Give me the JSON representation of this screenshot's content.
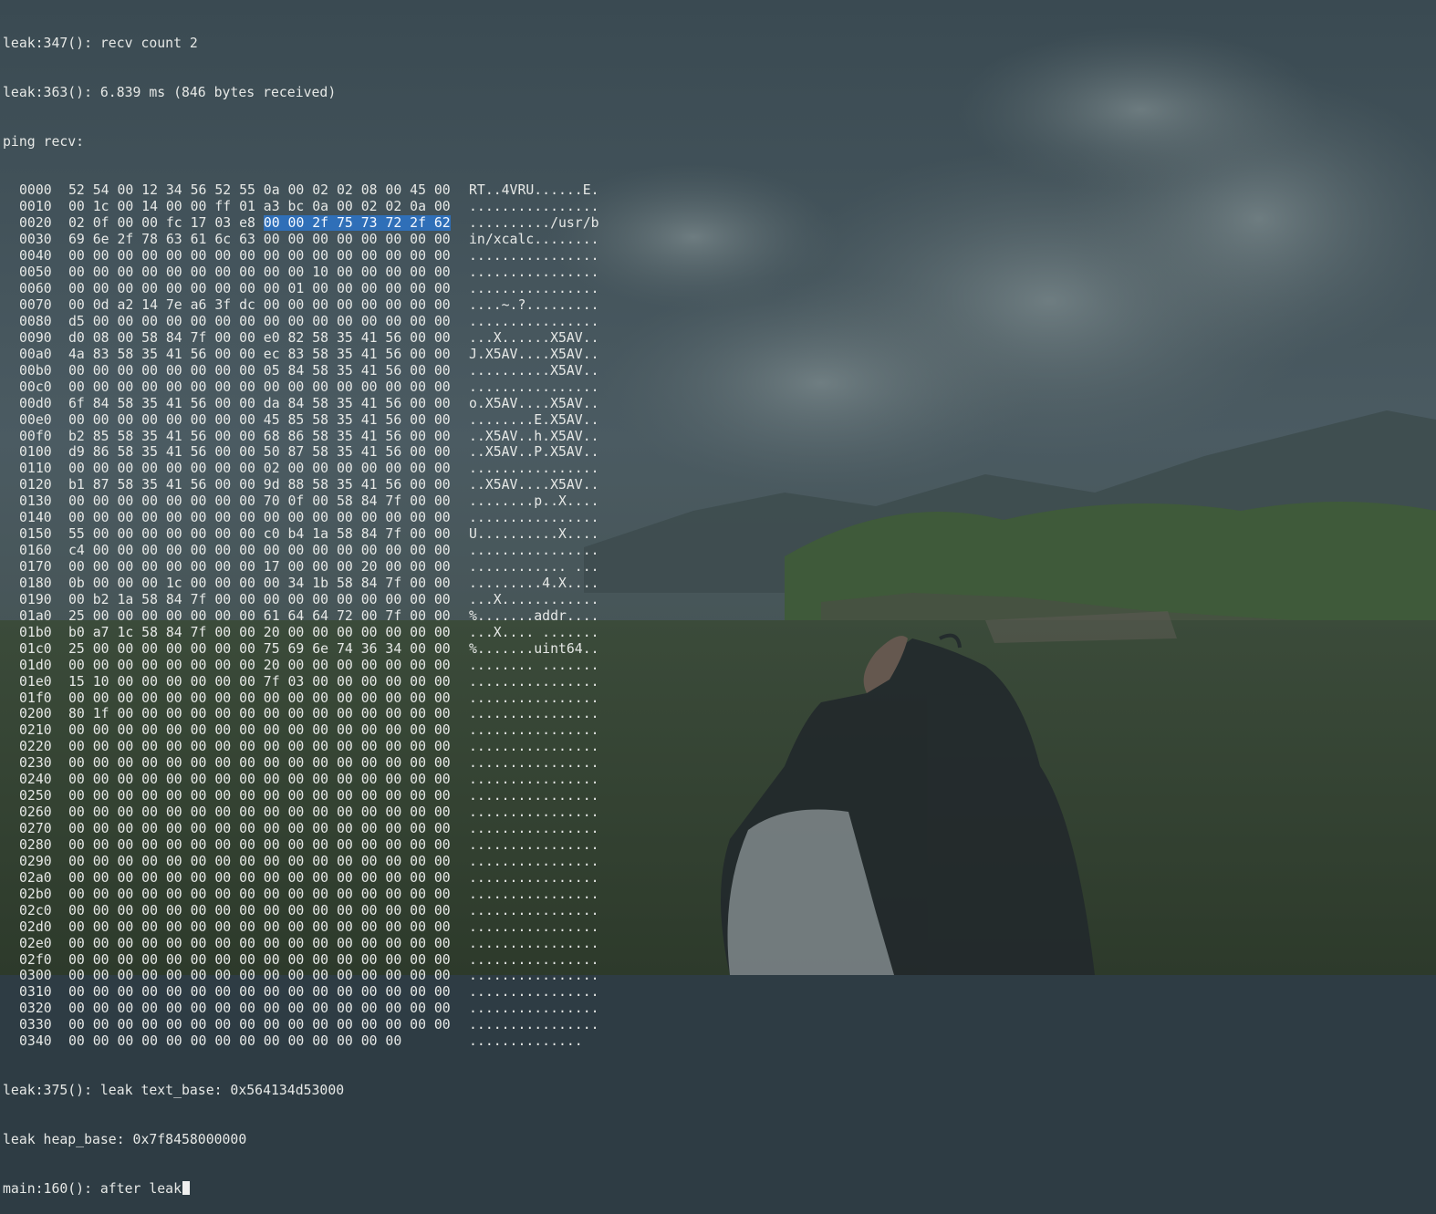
{
  "header_lines": [
    "leak:347(): recv count 2",
    "leak:363(): 6.839 ms (846 bytes received)",
    "ping recv:"
  ],
  "dump": [
    {
      "addr": "0000",
      "hex": "52 54 00 12 34 56 52 55 0a 00 02 02 08 00 45 00",
      "ascii": "RT..4VRU......E."
    },
    {
      "addr": "0010",
      "hex": "00 1c 00 14 00 00 ff 01 a3 bc 0a 00 02 02 0a 00",
      "ascii": "................"
    },
    {
      "addr": "0020",
      "hex": "02 0f 00 00 fc 17 03 e8 ",
      "hex_sel": "00 00 2f 75 73 72 2f 62",
      "ascii": "........../usr/b"
    },
    {
      "addr": "0030",
      "hex": "69 6e 2f 78 63 61 6c 63 00 00 00 00 00 00 00 00",
      "ascii": "in/xcalc........"
    },
    {
      "addr": "0040",
      "hex": "00 00 00 00 00 00 00 00 00 00 00 00 00 00 00 00",
      "ascii": "................"
    },
    {
      "addr": "0050",
      "hex": "00 00 00 00 00 00 00 00 00 00 10 00 00 00 00 00",
      "ascii": "................"
    },
    {
      "addr": "0060",
      "hex": "00 00 00 00 00 00 00 00 00 01 00 00 00 00 00 00",
      "ascii": "................"
    },
    {
      "addr": "0070",
      "hex": "00 0d a2 14 7e a6 3f dc 00 00 00 00 00 00 00 00",
      "ascii": "....~.?........."
    },
    {
      "addr": "0080",
      "hex": "d5 00 00 00 00 00 00 00 00 00 00 00 00 00 00 00",
      "ascii": "................"
    },
    {
      "addr": "0090",
      "hex": "d0 08 00 58 84 7f 00 00 e0 82 58 35 41 56 00 00",
      "ascii": "...X......X5AV.."
    },
    {
      "addr": "00a0",
      "hex": "4a 83 58 35 41 56 00 00 ec 83 58 35 41 56 00 00",
      "ascii": "J.X5AV....X5AV.."
    },
    {
      "addr": "00b0",
      "hex": "00 00 00 00 00 00 00 00 05 84 58 35 41 56 00 00",
      "ascii": "..........X5AV.."
    },
    {
      "addr": "00c0",
      "hex": "00 00 00 00 00 00 00 00 00 00 00 00 00 00 00 00",
      "ascii": "................"
    },
    {
      "addr": "00d0",
      "hex": "6f 84 58 35 41 56 00 00 da 84 58 35 41 56 00 00",
      "ascii": "o.X5AV....X5AV.."
    },
    {
      "addr": "00e0",
      "hex": "00 00 00 00 00 00 00 00 45 85 58 35 41 56 00 00",
      "ascii": "........E.X5AV.."
    },
    {
      "addr": "00f0",
      "hex": "b2 85 58 35 41 56 00 00 68 86 58 35 41 56 00 00",
      "ascii": "..X5AV..h.X5AV.."
    },
    {
      "addr": "0100",
      "hex": "d9 86 58 35 41 56 00 00 50 87 58 35 41 56 00 00",
      "ascii": "..X5AV..P.X5AV.."
    },
    {
      "addr": "0110",
      "hex": "00 00 00 00 00 00 00 00 02 00 00 00 00 00 00 00",
      "ascii": "................"
    },
    {
      "addr": "0120",
      "hex": "b1 87 58 35 41 56 00 00 9d 88 58 35 41 56 00 00",
      "ascii": "..X5AV....X5AV.."
    },
    {
      "addr": "0130",
      "hex": "00 00 00 00 00 00 00 00 70 0f 00 58 84 7f 00 00",
      "ascii": "........p..X...."
    },
    {
      "addr": "0140",
      "hex": "00 00 00 00 00 00 00 00 00 00 00 00 00 00 00 00",
      "ascii": "................"
    },
    {
      "addr": "0150",
      "hex": "55 00 00 00 00 00 00 00 c0 b4 1a 58 84 7f 00 00",
      "ascii": "U..........X...."
    },
    {
      "addr": "0160",
      "hex": "c4 00 00 00 00 00 00 00 00 00 00 00 00 00 00 00",
      "ascii": "................"
    },
    {
      "addr": "0170",
      "hex": "00 00 00 00 00 00 00 00 17 00 00 00 20 00 00 00",
      "ascii": "............ ..."
    },
    {
      "addr": "0180",
      "hex": "0b 00 00 00 1c 00 00 00 00 34 1b 58 84 7f 00 00",
      "ascii": ".........4.X...."
    },
    {
      "addr": "0190",
      "hex": "00 b2 1a 58 84 7f 00 00 00 00 00 00 00 00 00 00",
      "ascii": "...X............"
    },
    {
      "addr": "01a0",
      "hex": "25 00 00 00 00 00 00 00 61 64 64 72 00 7f 00 00",
      "ascii": "%.......addr...."
    },
    {
      "addr": "01b0",
      "hex": "b0 a7 1c 58 84 7f 00 00 20 00 00 00 00 00 00 00",
      "ascii": "...X.... ......."
    },
    {
      "addr": "01c0",
      "hex": "25 00 00 00 00 00 00 00 75 69 6e 74 36 34 00 00",
      "ascii": "%.......uint64.."
    },
    {
      "addr": "01d0",
      "hex": "00 00 00 00 00 00 00 00 20 00 00 00 00 00 00 00",
      "ascii": "........ ......."
    },
    {
      "addr": "01e0",
      "hex": "15 10 00 00 00 00 00 00 7f 03 00 00 00 00 00 00",
      "ascii": "................"
    },
    {
      "addr": "01f0",
      "hex": "00 00 00 00 00 00 00 00 00 00 00 00 00 00 00 00",
      "ascii": "................"
    },
    {
      "addr": "0200",
      "hex": "80 1f 00 00 00 00 00 00 00 00 00 00 00 00 00 00",
      "ascii": "................"
    },
    {
      "addr": "0210",
      "hex": "00 00 00 00 00 00 00 00 00 00 00 00 00 00 00 00",
      "ascii": "................"
    },
    {
      "addr": "0220",
      "hex": "00 00 00 00 00 00 00 00 00 00 00 00 00 00 00 00",
      "ascii": "................"
    },
    {
      "addr": "0230",
      "hex": "00 00 00 00 00 00 00 00 00 00 00 00 00 00 00 00",
      "ascii": "................"
    },
    {
      "addr": "0240",
      "hex": "00 00 00 00 00 00 00 00 00 00 00 00 00 00 00 00",
      "ascii": "................"
    },
    {
      "addr": "0250",
      "hex": "00 00 00 00 00 00 00 00 00 00 00 00 00 00 00 00",
      "ascii": "................"
    },
    {
      "addr": "0260",
      "hex": "00 00 00 00 00 00 00 00 00 00 00 00 00 00 00 00",
      "ascii": "................"
    },
    {
      "addr": "0270",
      "hex": "00 00 00 00 00 00 00 00 00 00 00 00 00 00 00 00",
      "ascii": "................"
    },
    {
      "addr": "0280",
      "hex": "00 00 00 00 00 00 00 00 00 00 00 00 00 00 00 00",
      "ascii": "................"
    },
    {
      "addr": "0290",
      "hex": "00 00 00 00 00 00 00 00 00 00 00 00 00 00 00 00",
      "ascii": "................"
    },
    {
      "addr": "02a0",
      "hex": "00 00 00 00 00 00 00 00 00 00 00 00 00 00 00 00",
      "ascii": "................"
    },
    {
      "addr": "02b0",
      "hex": "00 00 00 00 00 00 00 00 00 00 00 00 00 00 00 00",
      "ascii": "................"
    },
    {
      "addr": "02c0",
      "hex": "00 00 00 00 00 00 00 00 00 00 00 00 00 00 00 00",
      "ascii": "................"
    },
    {
      "addr": "02d0",
      "hex": "00 00 00 00 00 00 00 00 00 00 00 00 00 00 00 00",
      "ascii": "................"
    },
    {
      "addr": "02e0",
      "hex": "00 00 00 00 00 00 00 00 00 00 00 00 00 00 00 00",
      "ascii": "................"
    },
    {
      "addr": "02f0",
      "hex": "00 00 00 00 00 00 00 00 00 00 00 00 00 00 00 00",
      "ascii": "................"
    },
    {
      "addr": "0300",
      "hex": "00 00 00 00 00 00 00 00 00 00 00 00 00 00 00 00",
      "ascii": "................"
    },
    {
      "addr": "0310",
      "hex": "00 00 00 00 00 00 00 00 00 00 00 00 00 00 00 00",
      "ascii": "................"
    },
    {
      "addr": "0320",
      "hex": "00 00 00 00 00 00 00 00 00 00 00 00 00 00 00 00",
      "ascii": "................"
    },
    {
      "addr": "0330",
      "hex": "00 00 00 00 00 00 00 00 00 00 00 00 00 00 00 00",
      "ascii": "................"
    },
    {
      "addr": "0340",
      "hex": "00 00 00 00 00 00 00 00 00 00 00 00 00 00",
      "ascii": ".............."
    }
  ],
  "footer_lines": [
    "leak:375(): leak text_base: 0x564134d53000",
    "leak heap_base: 0x7f8458000000"
  ],
  "prompt_line": "main:160(): after leak",
  "colors": {
    "text": "#e6e8e6",
    "selection": "#2f6fb8"
  }
}
